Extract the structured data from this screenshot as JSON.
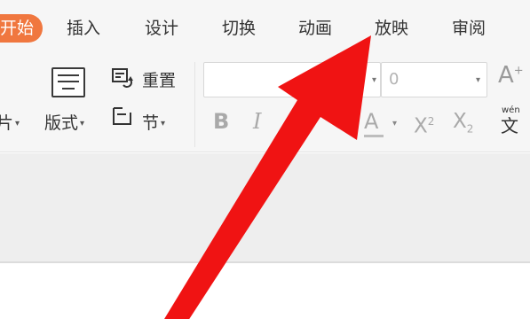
{
  "tabs": {
    "home": "开始",
    "insert": "插入",
    "design": "设计",
    "transitions": "切换",
    "animation": "动画",
    "slideshow": "放映",
    "review": "审阅"
  },
  "ribbon": {
    "picture_partial": "片",
    "layout": "版式",
    "reset": "重置",
    "section": "节",
    "font_size": "0",
    "bold": "B",
    "italic": "I",
    "font_color": "A",
    "superscript": "X",
    "superscript_mark": "2",
    "subscript": "X",
    "subscript_mark": "2",
    "grow_font": "A",
    "grow_mark": "+",
    "phonetic": "文",
    "phonetic_mark": "wén"
  },
  "colors": {
    "active_tab": "#f0773f",
    "arrow": "#f01313"
  },
  "icons": [
    "layout-icon",
    "reset-icon",
    "section-icon",
    "dropdown-caret-icon",
    "red-pointer-arrow"
  ]
}
